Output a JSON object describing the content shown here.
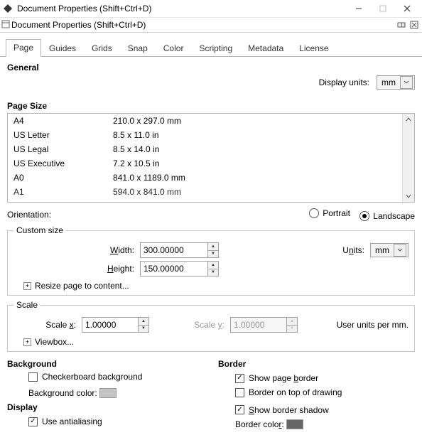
{
  "window": {
    "title": "Document Properties (Shift+Ctrl+D)",
    "subtitle": "Document Properties (Shift+Ctrl+D)"
  },
  "tabs": [
    "Page",
    "Guides",
    "Grids",
    "Snap",
    "Color",
    "Scripting",
    "Metadata",
    "License"
  ],
  "general": {
    "heading": "General",
    "display_units_label": "Display units:",
    "display_units_value": "mm"
  },
  "page_size": {
    "heading": "Page Size",
    "rows": [
      {
        "name": "A4",
        "dims": "210.0 x 297.0 mm"
      },
      {
        "name": "US Letter",
        "dims": "8.5 x 11.0 in"
      },
      {
        "name": "US Legal",
        "dims": "8.5 x 14.0 in"
      },
      {
        "name": "US Executive",
        "dims": "7.2 x 10.5 in"
      },
      {
        "name": "A0",
        "dims": "841.0 x 1189.0 mm"
      },
      {
        "name": "A1",
        "dims": "594.0 x 841.0 mm"
      }
    ]
  },
  "orientation": {
    "label": "Orientation:",
    "portrait": "Portrait",
    "landscape": "Landscape",
    "selected": "landscape"
  },
  "custom_size": {
    "legend": "Custom size",
    "width_label": "Width:",
    "height_label": "Height:",
    "width_value": "300.00000",
    "height_value": "150.00000",
    "units_label": "Units:",
    "units_value": "mm",
    "resize_label": "Resize page to content..."
  },
  "scale": {
    "legend": "Scale",
    "scale_x_label": "Scale x:",
    "scale_y_label": "Scale y:",
    "scale_x_value": "1.00000",
    "scale_y_value": "1.00000",
    "suffix": "User units per mm.",
    "viewbox_label": "Viewbox..."
  },
  "background": {
    "heading": "Background",
    "checkerboard_label": "Checkerboard background",
    "checkerboard_checked": false,
    "color_label": "Background color:",
    "color_value": "#c4c4c4"
  },
  "display": {
    "heading": "Display",
    "antialias_label": "Use antialiasing",
    "antialias_checked": true
  },
  "border": {
    "heading": "Border",
    "show_border_label_pre": "Show page ",
    "show_border_label_u": "b",
    "show_border_label_post": "order",
    "show_border_checked": true,
    "on_top_label": "Border on top of drawing",
    "on_top_checked": false,
    "shadow_label_pre": "",
    "shadow_label_u": "S",
    "shadow_label_post": "how border shadow",
    "shadow_checked": true,
    "color_label": "Border color:",
    "color_value": "#666666"
  }
}
